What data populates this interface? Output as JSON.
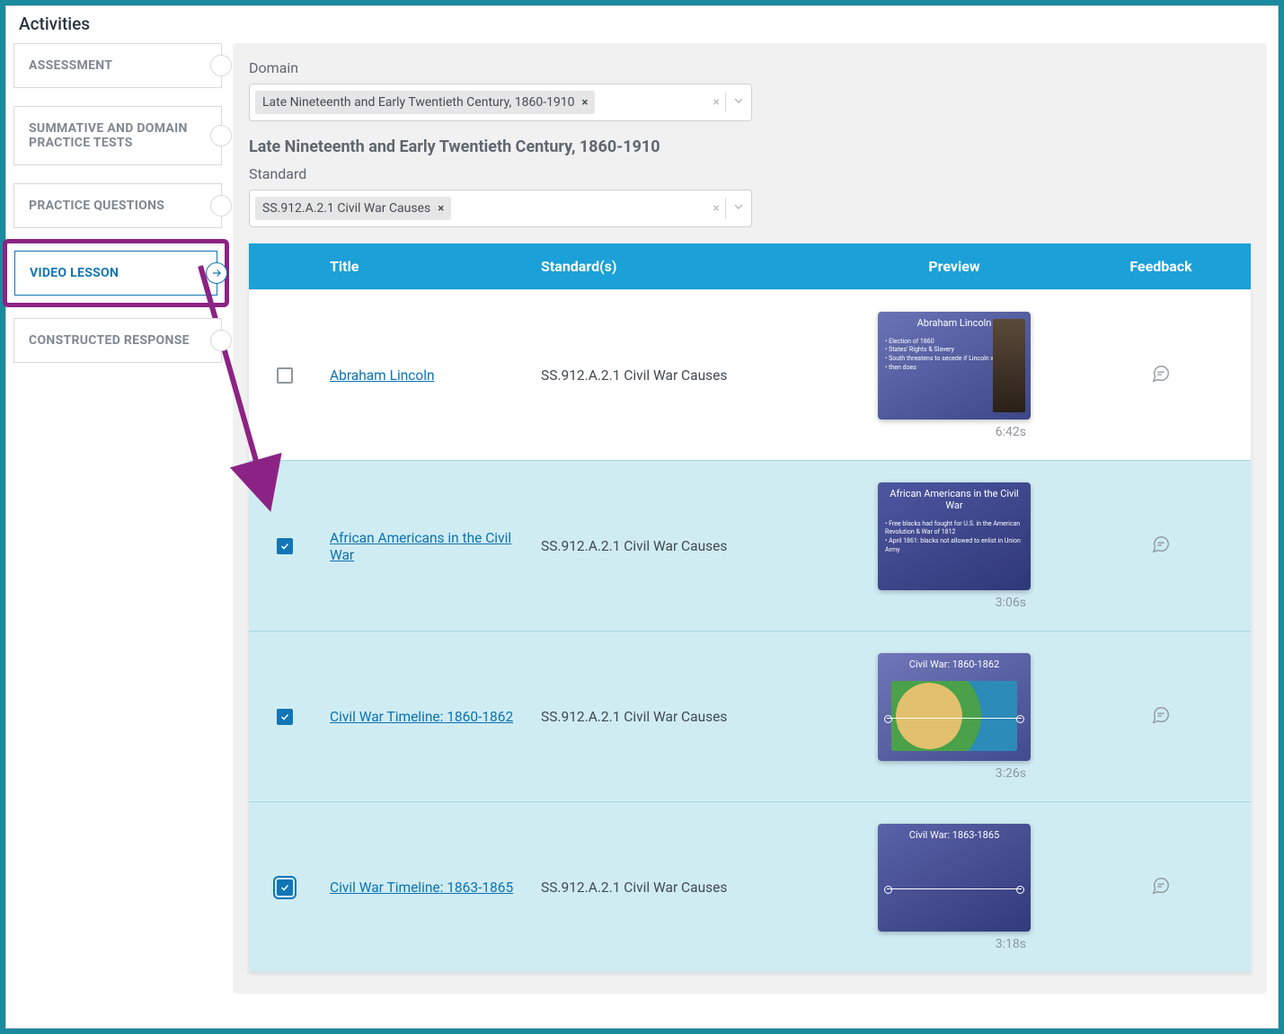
{
  "header": {
    "title": "Activities"
  },
  "sidebar": {
    "items": [
      {
        "label": "ASSESSMENT"
      },
      {
        "label": "SUMMATIVE AND DOMAIN PRACTICE TESTS"
      },
      {
        "label": "PRACTICE QUESTIONS"
      },
      {
        "label": "VIDEO LESSON"
      },
      {
        "label": "CONSTRUCTED RESPONSE"
      }
    ]
  },
  "filters": {
    "domain_label": "Domain",
    "domain_tag": "Late Nineteenth and Early Twentieth Century, 1860-1910",
    "section_title": "Late Nineteenth and Early Twentieth Century, 1860-1910",
    "standard_label": "Standard",
    "standard_tag": "SS.912.A.2.1 Civil War Causes"
  },
  "table": {
    "headers": {
      "title": "Title",
      "standards": "Standard(s)",
      "preview": "Preview",
      "feedback": "Feedback"
    },
    "rows": [
      {
        "checked": false,
        "title": "Abraham Lincoln",
        "standard": "SS.912.A.2.1 Civil War Causes",
        "thumb_title": "Abraham Lincoln",
        "duration": "6:42s"
      },
      {
        "checked": true,
        "title": "African Americans in the Civil War",
        "standard": "SS.912.A.2.1 Civil War Causes",
        "thumb_title": "African Americans in the Civil War",
        "duration": "3:06s"
      },
      {
        "checked": true,
        "title": "Civil War Timeline: 1860-1862",
        "standard": "SS.912.A.2.1 Civil War Causes",
        "thumb_title": "Civil War: 1860-1862",
        "duration": "3:26s"
      },
      {
        "checked": true,
        "outlined": true,
        "title": "Civil War Timeline: 1863-1865",
        "standard": "SS.912.A.2.1 Civil War Causes",
        "thumb_title": "Civil War: 1863-1865",
        "duration": "3:18s"
      }
    ]
  }
}
